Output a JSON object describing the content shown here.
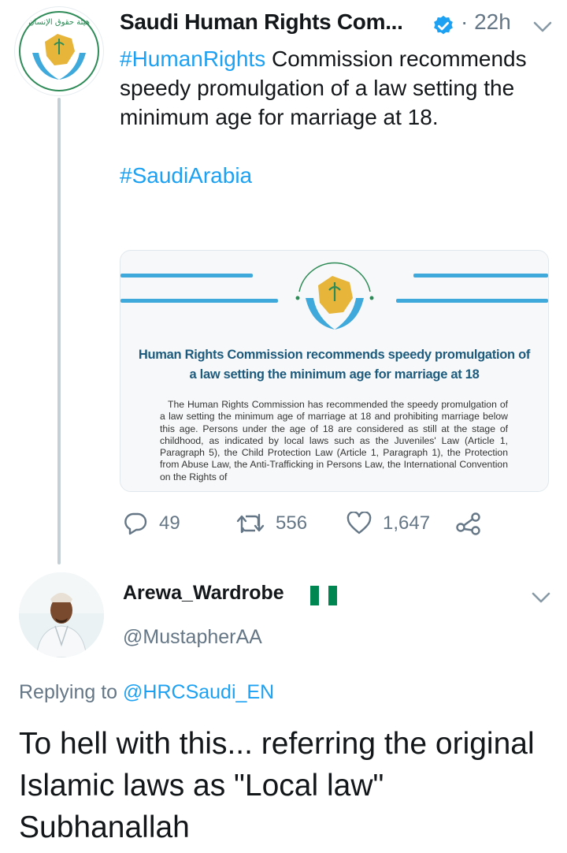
{
  "tweet": {
    "author_name": "Saudi Human Rights Com...",
    "time": "· 22h",
    "text_hashtag": "#HumanRights",
    "text_body": " Commission recommends speedy promulgation of a law setting the minimum age for marriage at 18.",
    "hashtag2": "#SaudiArabia",
    "logo_text": "Human Rights Commission",
    "card": {
      "title": "Human Rights Commission recommends speedy promulgation of a law setting the minimum age for marriage at 18",
      "body": "The Human Rights Commission has recommended the speedy promulgation of a law setting the minimum age of marriage at 18 and prohibiting marriage below this age. Persons under the age of 18 are considered as still at the stage of childhood, as indicated by local laws such as the Juveniles' Law (Article 1, Paragraph 5), the Child Protection Law (Article 1, Paragraph 1), the Protection from Abuse Law, the Anti-Trafficking in Persons Law, the International Convention on the Rights of"
    },
    "actions": {
      "replies": "49",
      "retweets": "556",
      "likes": "1,647"
    }
  },
  "reply": {
    "name": "Arewa_Wardrobe",
    "handle": "@MustapherAA",
    "replying_prefix": "Replying to ",
    "replying_to": "@HRCSaudi_EN",
    "text": "To hell with this... referring the original Islamic laws as \"Local law\" Subhanallah"
  },
  "colors": {
    "accent": "#1da1f2",
    "secondary_text": "#657786",
    "thread_line": "#c4cfd6",
    "nigeria_green": "#008751"
  },
  "icons": [
    "verified-badge-icon",
    "chevron-down-icon",
    "reply-icon",
    "retweet-icon",
    "like-icon",
    "share-icon",
    "nigeria-flag-icon"
  ]
}
